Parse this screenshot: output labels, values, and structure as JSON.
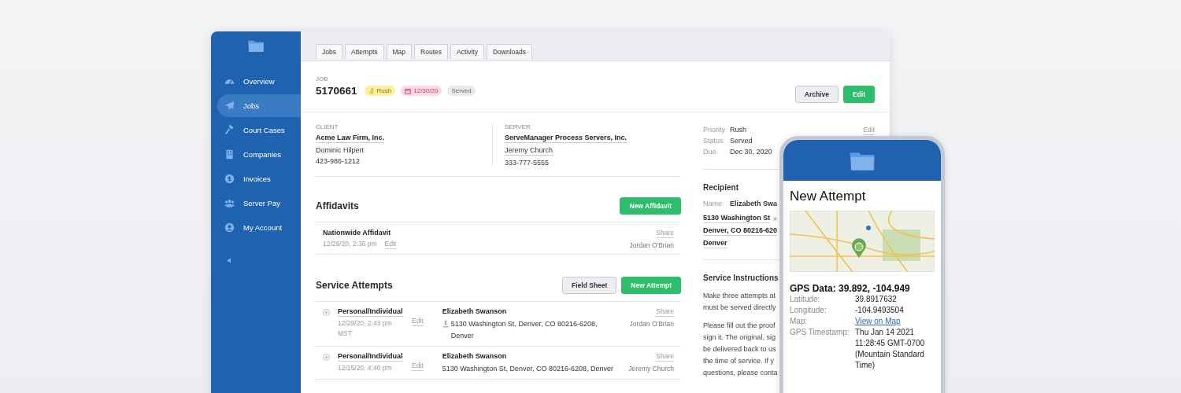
{
  "sidebar": {
    "items": [
      {
        "label": "Overview",
        "selected": false
      },
      {
        "label": "Jobs",
        "selected": true
      },
      {
        "label": "Court Cases",
        "selected": false
      },
      {
        "label": "Companies",
        "selected": false
      },
      {
        "label": "Invoices",
        "selected": false
      },
      {
        "label": "Server Pay",
        "selected": false
      },
      {
        "label": "My Account",
        "selected": false
      }
    ]
  },
  "tabs": [
    {
      "label": "Jobs"
    },
    {
      "label": "Attempts"
    },
    {
      "label": "Map"
    },
    {
      "label": "Routes"
    },
    {
      "label": "Activity"
    },
    {
      "label": "Downloads"
    }
  ],
  "job": {
    "label": "JOB",
    "number": "5170661",
    "badges": [
      {
        "kind": "rush",
        "text": "Rush"
      },
      {
        "kind": "date",
        "text": "12/30/20"
      },
      {
        "kind": "status",
        "text": "Served"
      }
    ],
    "buttons": [
      {
        "kind": "secondary",
        "label": "Archive"
      },
      {
        "kind": "primary",
        "label": "Edit"
      }
    ]
  },
  "client": {
    "heading": "CLIENT",
    "name": "Acme Law Firm, Inc.",
    "contact": "Dominic Hilpert",
    "phone": "423-986-1212"
  },
  "server": {
    "heading": "SERVER",
    "name": "ServeManager Process Servers, Inc.",
    "contact": "Jeremy Church",
    "phone": "333-777-5555"
  },
  "details": {
    "edit": "Edit",
    "fields": [
      {
        "label": "Priority",
        "value": "Rush"
      },
      {
        "label": "Status",
        "value": "Served"
      },
      {
        "label": "Due",
        "value": "Dec 30, 2020"
      }
    ]
  },
  "recipient": {
    "heading": "Recipient",
    "name_label": "Name",
    "name": "Elizabeth Swa",
    "address_lines": [
      "5130 Washington St",
      "Denver, CO 80216-620",
      "Denver"
    ]
  },
  "instructions": {
    "heading": "Service Instructions",
    "paragraphs": [
      [
        "Make three attempts at",
        "must be served directly"
      ],
      [
        "Please fill out the proof",
        "sign it. The original, sig",
        "be delivered back to us",
        "the time of service. If y",
        "questions, please conta"
      ]
    ]
  },
  "affidavits": {
    "title": "Affidavits",
    "button": "New Affidavit",
    "rows": [
      {
        "name": "Nationwide Affidavit",
        "date": "12/29/20, 2:36 pm",
        "edit": "Edit",
        "share": "Share",
        "person": "Jordan O'Brian"
      }
    ]
  },
  "service_attempts": {
    "title": "Service Attempts",
    "buttons": [
      {
        "kind": "secondary",
        "label": "Field Sheet"
      },
      {
        "kind": "primary",
        "label": "New Attempt"
      }
    ],
    "rows": [
      {
        "type": "Personal/Individual",
        "date": "12/29/20, 2:43 pm",
        "tz": "MST",
        "edit": "Edit",
        "recipient": "Elizabeth Swanson",
        "gps": true,
        "address": "5130 Washington St, Denver, CO 80216-6208, Denver",
        "share": "Share",
        "person": "Jordan O'Brian"
      },
      {
        "type": "Personal/Individual",
        "date": "12/15/20, 4:40 pm",
        "edit": "Edit",
        "recipient": "Elizabeth Swanson",
        "gps": false,
        "address": "5130 Washington St, Denver, CO 80216-6208, Denver",
        "share": "Share",
        "person": "Jeremy Church"
      }
    ]
  },
  "phone": {
    "title": "New Attempt",
    "gps_heading": "GPS Data: 39.892, -104.949",
    "fields": [
      {
        "kind": "text",
        "label": "Latitude:",
        "value": "39.8917632"
      },
      {
        "kind": "text",
        "label": "Longitude:",
        "value": "-104.9493504"
      },
      {
        "kind": "link",
        "label": "Map:",
        "value": "View on Map"
      },
      {
        "kind": "text",
        "label": "GPS Timestamp:",
        "value": "Thu Jan 14 2021 11:28:45 GMT-0700 (Mountain Standard Time)"
      }
    ]
  }
}
